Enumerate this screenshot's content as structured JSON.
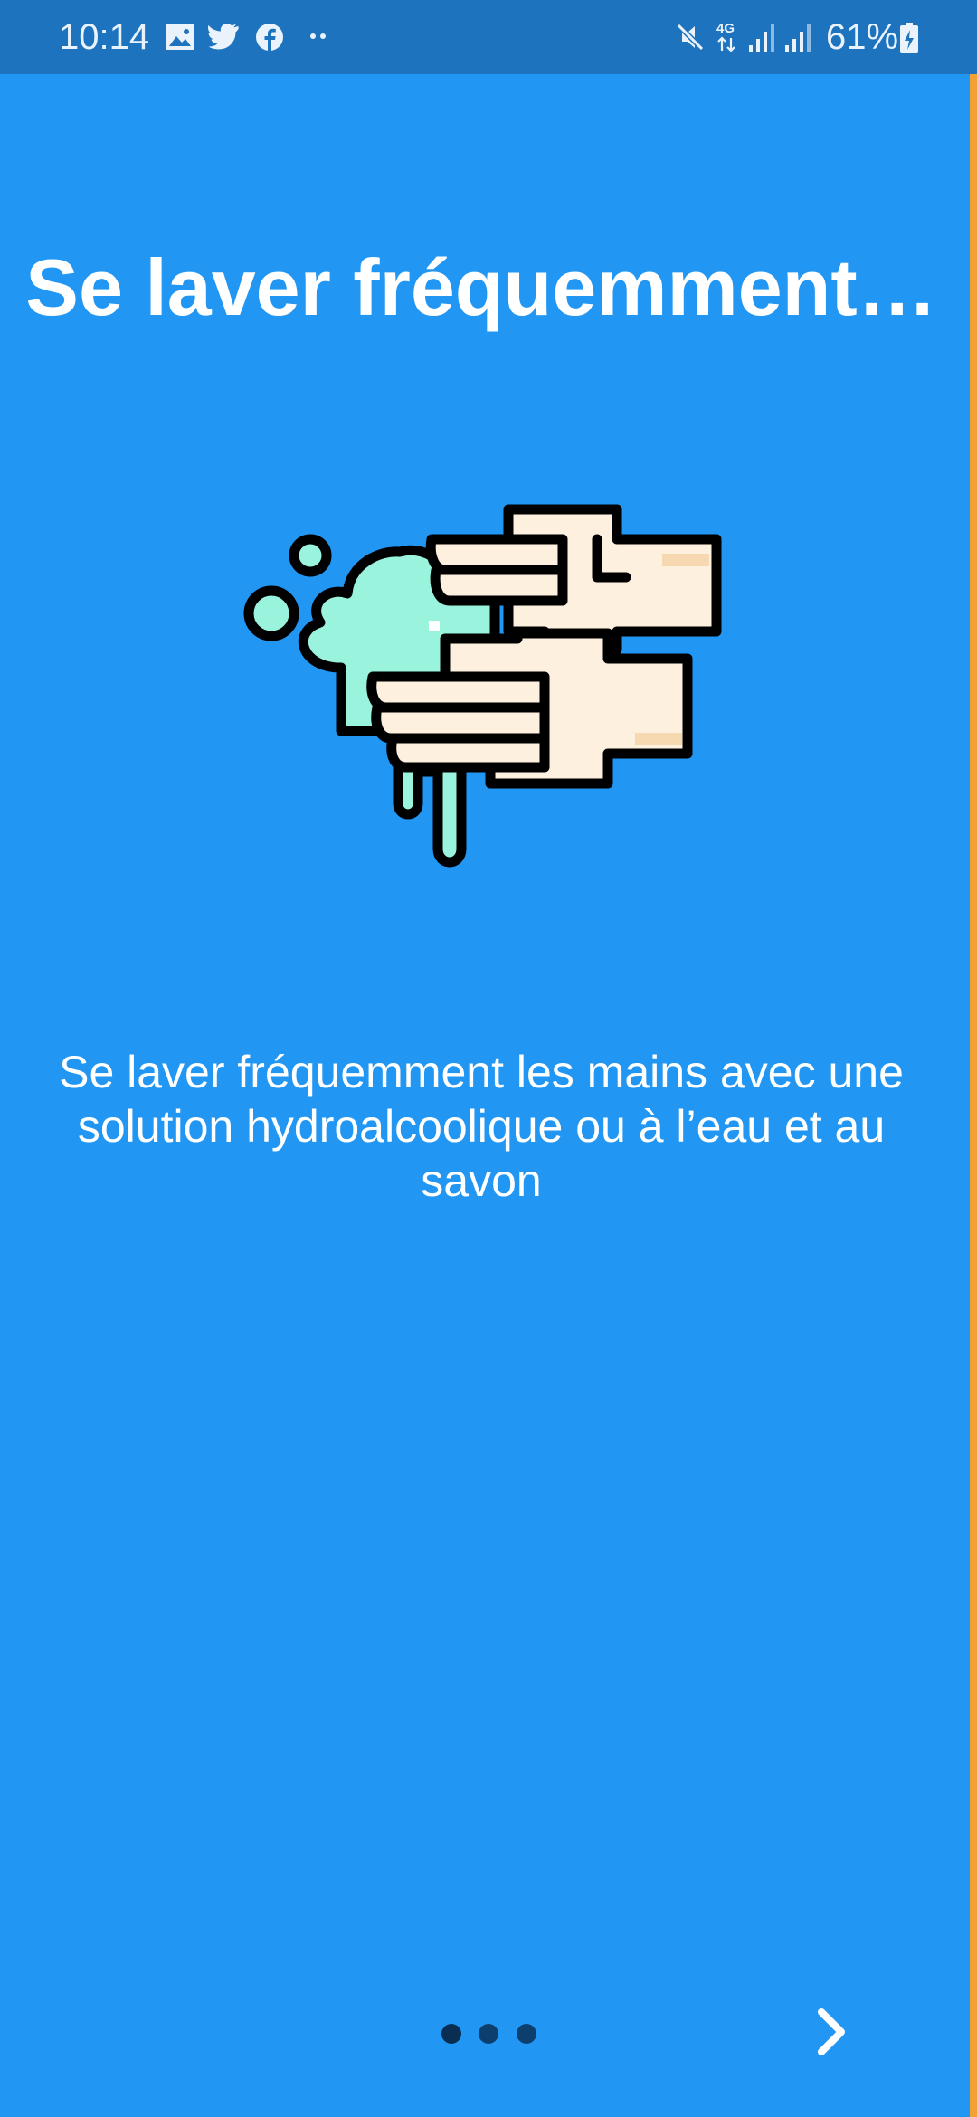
{
  "status_bar": {
    "time": "10:14",
    "battery": "61%",
    "icons": [
      "gallery-icon",
      "twitter-icon",
      "facebook-icon",
      "more-notifications-icon",
      "mute-icon",
      "4g-icon",
      "signal-icon",
      "signal-icon",
      "battery-icon"
    ]
  },
  "page": {
    "title": "Se laver fréquemment…",
    "description": "Se laver fréquemment les mains avec une solution hydroalcoolique ou à l’eau et au savon",
    "illustration_icon": "handwashing-icon"
  },
  "pager": {
    "total_pages": 3,
    "current_page": 1
  },
  "navigation": {
    "next_icon": "chevron-right-icon"
  },
  "colors": {
    "background": "#2196F3",
    "status_bar": "#1E73BE",
    "edge": "#F2A234",
    "soap": "#9AF3DD",
    "skin": "#FDF0DE"
  }
}
